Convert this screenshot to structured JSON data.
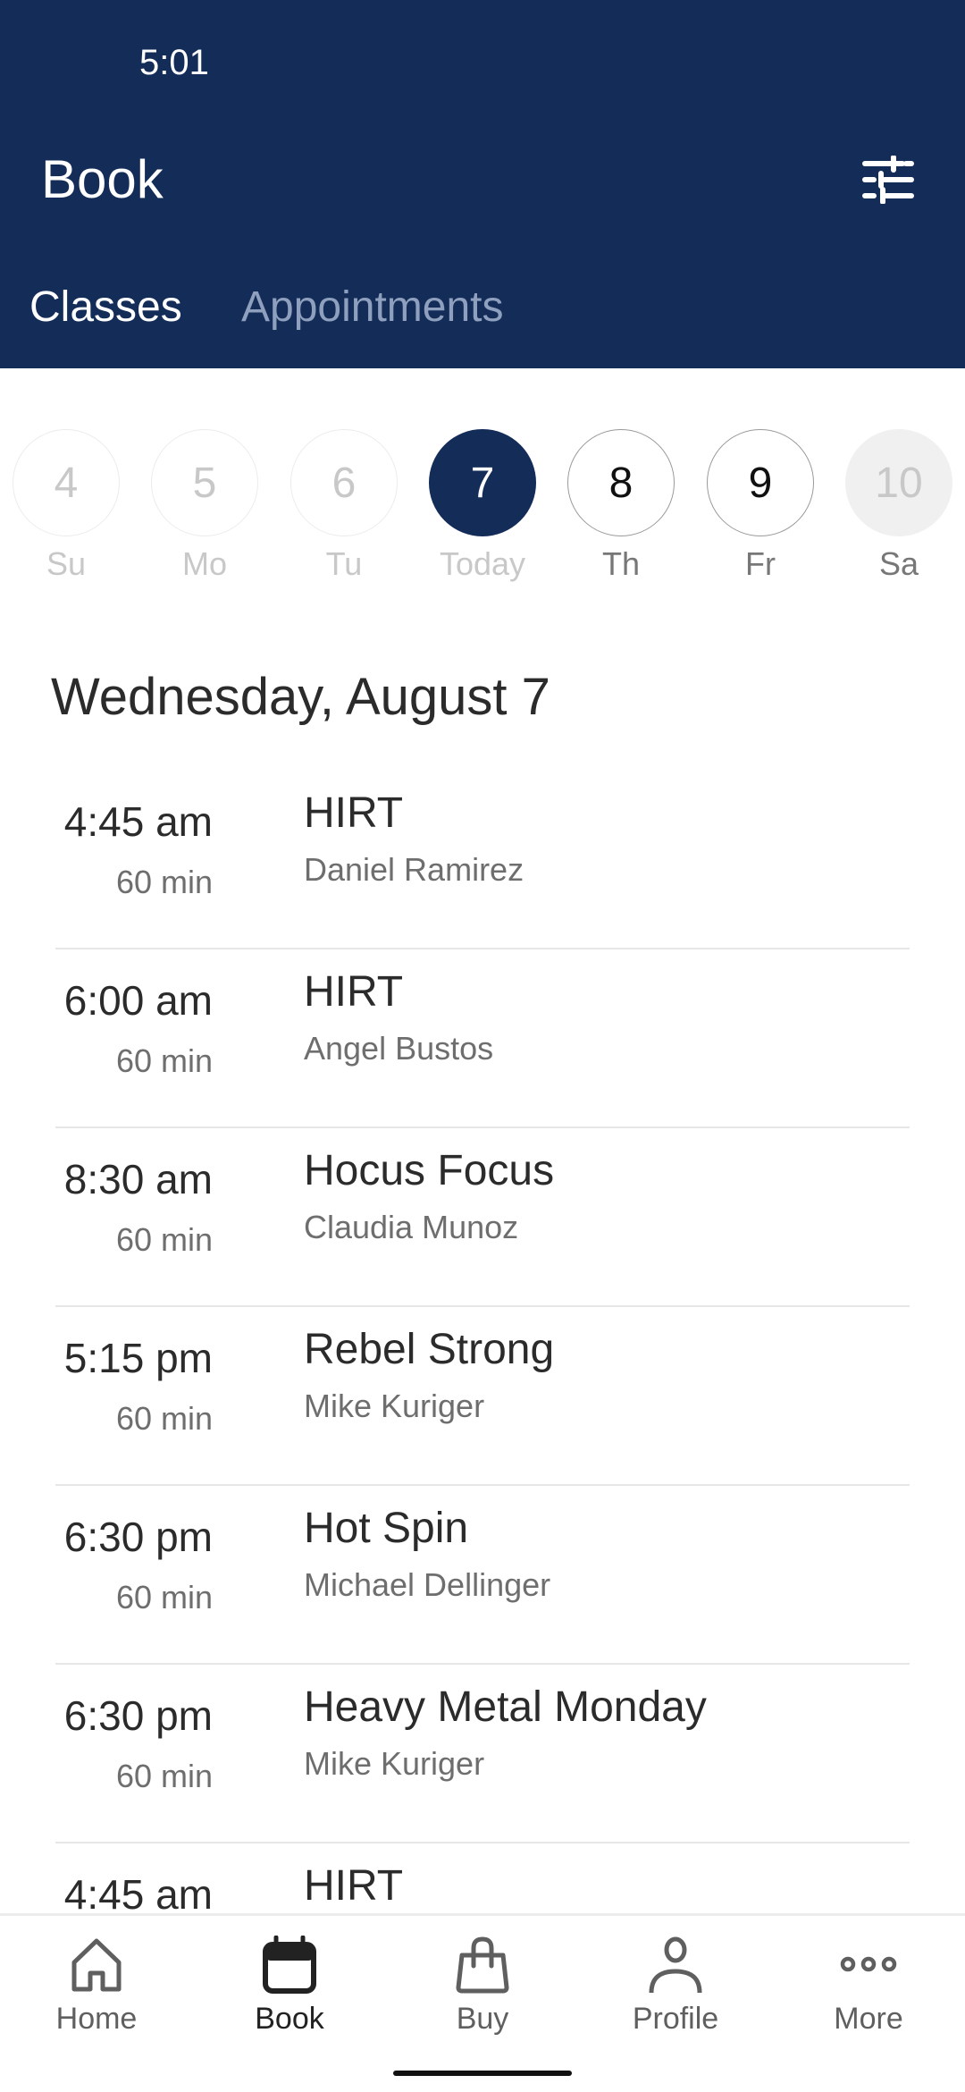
{
  "status_bar": {
    "time": "5:01"
  },
  "header": {
    "title": "Book",
    "filter_icon": "sliders-icon",
    "tabs": [
      {
        "label": "Classes",
        "active": true
      },
      {
        "label": "Appointments",
        "active": false
      }
    ]
  },
  "date_strip": {
    "days": [
      {
        "number": "4",
        "label": "Su",
        "state": "past"
      },
      {
        "number": "5",
        "label": "Mo",
        "state": "past"
      },
      {
        "number": "6",
        "label": "Tu",
        "state": "past"
      },
      {
        "number": "7",
        "label": "Today",
        "state": "selected"
      },
      {
        "number": "8",
        "label": "Th",
        "state": "future"
      },
      {
        "number": "9",
        "label": "Fr",
        "state": "future"
      },
      {
        "number": "10",
        "label": "Sa",
        "state": "unavailable"
      }
    ]
  },
  "schedule": {
    "date_heading": "Wednesday, August 7",
    "classes": [
      {
        "time": "4:45 am",
        "duration": "60 min",
        "name": "HIRT",
        "instructor": "Daniel Ramirez"
      },
      {
        "time": "6:00 am",
        "duration": "60 min",
        "name": "HIRT",
        "instructor": "Angel Bustos"
      },
      {
        "time": "8:30 am",
        "duration": "60 min",
        "name": "Hocus Focus",
        "instructor": "Claudia Munoz"
      },
      {
        "time": "5:15 pm",
        "duration": "60 min",
        "name": "Rebel Strong",
        "instructor": "Mike Kuriger"
      },
      {
        "time": "6:30 pm",
        "duration": "60 min",
        "name": "Hot Spin",
        "instructor": "Michael Dellinger"
      },
      {
        "time": "6:30 pm",
        "duration": "60 min",
        "name": "Heavy Metal Monday",
        "instructor": "Mike Kuriger"
      },
      {
        "time": "4:45 am",
        "duration": "",
        "name": "HIRT",
        "instructor": ""
      }
    ]
  },
  "bottom_nav": {
    "items": [
      {
        "label": "Home",
        "icon": "home-icon",
        "active": false
      },
      {
        "label": "Book",
        "icon": "calendar-icon",
        "active": true
      },
      {
        "label": "Buy",
        "icon": "shopping-bag-icon",
        "active": false
      },
      {
        "label": "Profile",
        "icon": "person-icon",
        "active": false
      },
      {
        "label": "More",
        "icon": "more-dots-icon",
        "active": false
      }
    ]
  },
  "colors": {
    "brand_navy": "#142c58",
    "inactive_tab": "#8ea0bd",
    "text_primary": "#2b2b2b",
    "text_secondary": "#6e6e6e"
  }
}
